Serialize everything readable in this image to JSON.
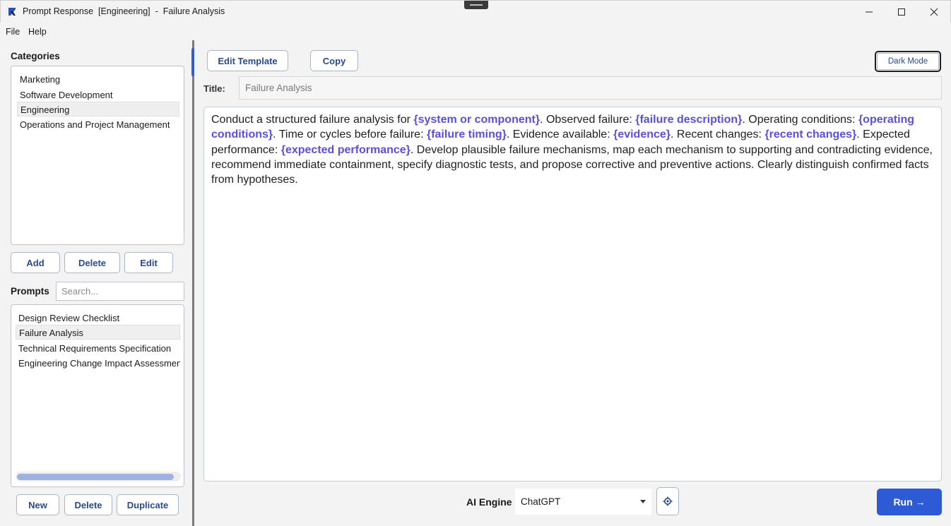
{
  "window": {
    "title": "Prompt Response  [Engineering]  -  Failure Analysis"
  },
  "menu": {
    "file": "File",
    "help": "Help"
  },
  "categories": {
    "heading": "Categories",
    "items": [
      "Marketing",
      "Software Development",
      "Engineering",
      "Operations and Project Management"
    ],
    "selected": "Engineering",
    "buttons": {
      "add": "Add",
      "delete": "Delete",
      "edit": "Edit"
    }
  },
  "prompts": {
    "heading": "Prompts",
    "search_placeholder": "Search...",
    "items": [
      "Design Review Checklist",
      "Failure Analysis",
      "Technical Requirements Specification",
      "Engineering Change Impact Assessment"
    ],
    "selected": "Failure Analysis",
    "buttons": {
      "new": "New",
      "delete": "Delete",
      "duplicate": "Duplicate"
    }
  },
  "toolbar": {
    "edit_template": "Edit Template",
    "copy": "Copy",
    "dark_mode": "Dark Mode"
  },
  "prompt": {
    "title_label": "Title:",
    "title_value": "Failure Analysis",
    "segments": [
      {
        "text": "Conduct a structured failure analysis for ",
        "var": false
      },
      {
        "text": "{system or component}",
        "var": true
      },
      {
        "text": ". Observed failure: ",
        "var": false
      },
      {
        "text": "{failure description}",
        "var": true
      },
      {
        "text": ". Operating conditions: ",
        "var": false
      },
      {
        "text": "{operating conditions}",
        "var": true
      },
      {
        "text": ". Time or cycles before failure: ",
        "var": false
      },
      {
        "text": "{failure timing}",
        "var": true
      },
      {
        "text": ". Evidence available: ",
        "var": false
      },
      {
        "text": "{evidence}",
        "var": true
      },
      {
        "text": ". Recent changes: ",
        "var": false
      },
      {
        "text": "{recent changes}",
        "var": true
      },
      {
        "text": ". Expected performance: ",
        "var": false
      },
      {
        "text": "{expected performance}",
        "var": true
      },
      {
        "text": ". Develop plausible failure mechanisms, map each mechanism to supporting and contradicting evidence, recommend immediate containment, specify diagnostic tests, and propose corrective and preventive actions. Clearly distinguish confirmed facts from hypotheses.",
        "var": false
      }
    ]
  },
  "engine": {
    "label": "AI Engine",
    "selected": "ChatGPT",
    "run": "Run →"
  },
  "colors": {
    "accent": "#2d5bd6",
    "variable": "#5b4fe0",
    "button_text": "#2a4a8a"
  }
}
